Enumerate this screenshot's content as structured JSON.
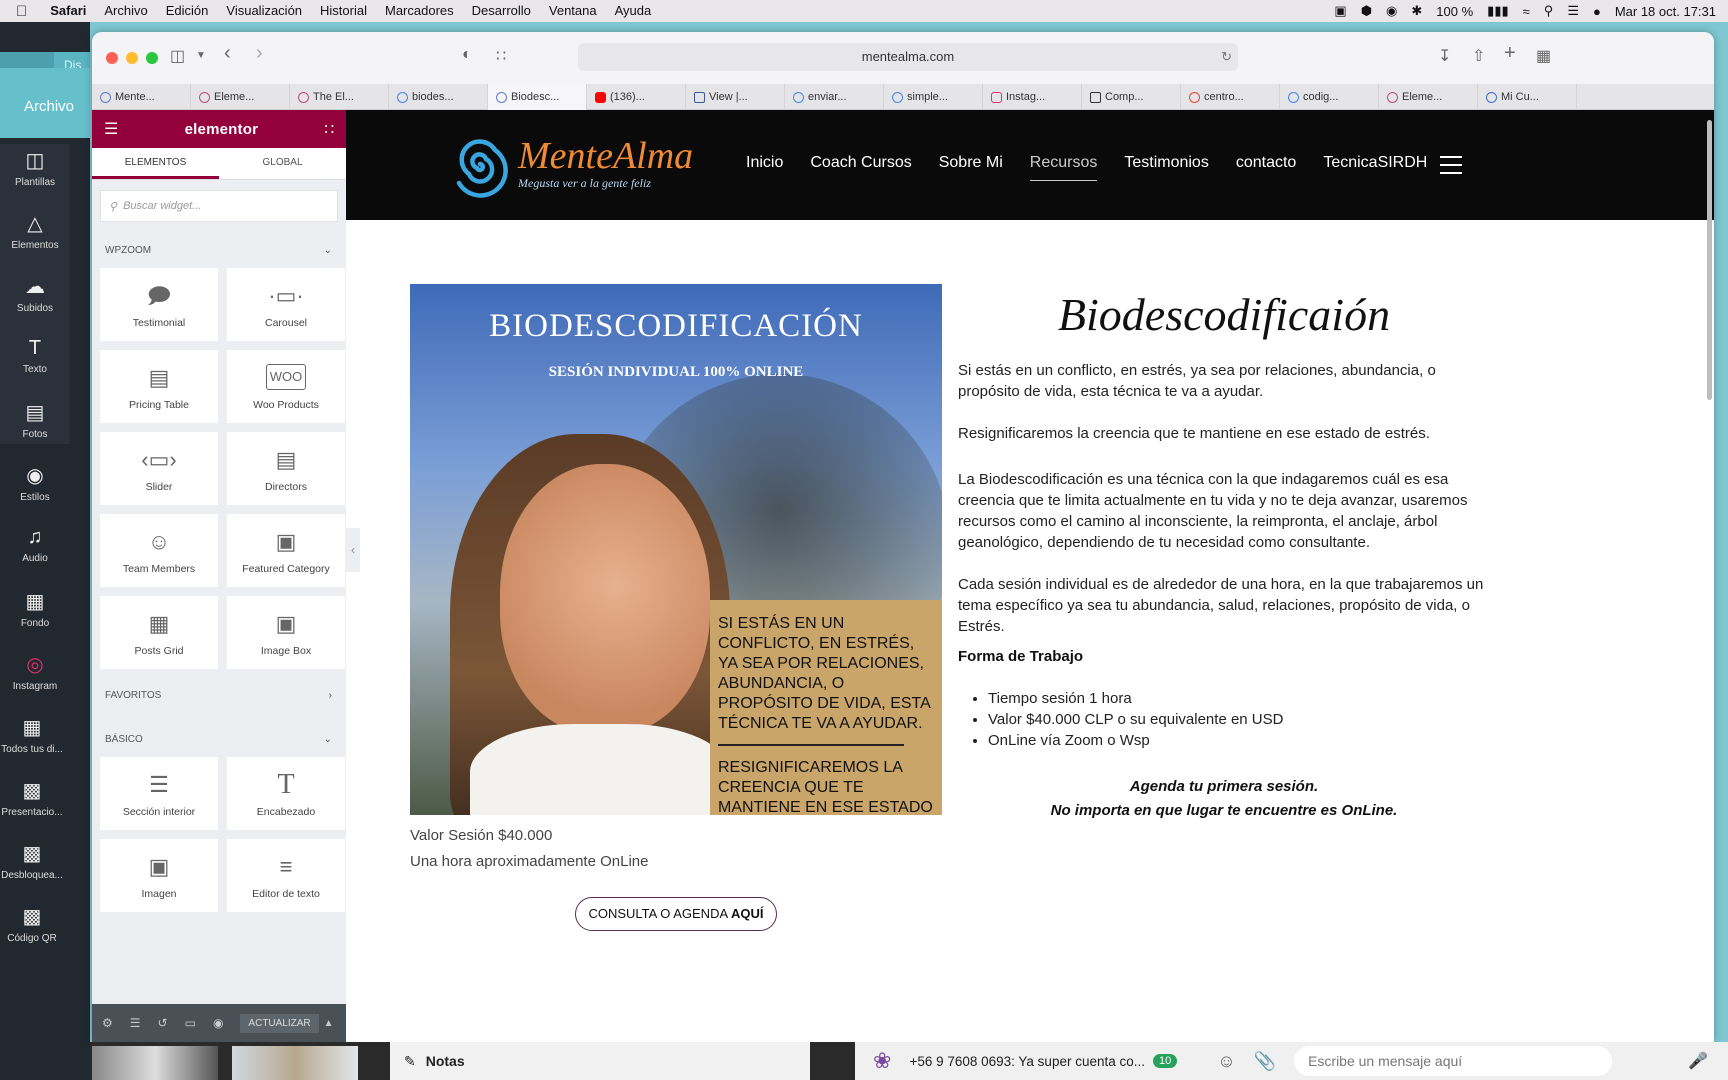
{
  "menubar": {
    "app": "Safari",
    "items": [
      "Archivo",
      "Edición",
      "Visualización",
      "Historial",
      "Marcadores",
      "Desarrollo",
      "Ventana",
      "Ayuda"
    ],
    "battery": "100 %",
    "datetime": "Mar 18 oct.  17:31"
  },
  "background_app": {
    "archivo": "Archivo",
    "partial_tab": "Dis",
    "sidebar": [
      {
        "label": "Plantillas",
        "icon": "templates-icon"
      },
      {
        "label": "Elementos",
        "icon": "elements-icon"
      },
      {
        "label": "Subidos",
        "icon": "upload-icon"
      },
      {
        "label": "Texto",
        "icon": "text-icon"
      },
      {
        "label": "Fotos",
        "icon": "photos-icon"
      },
      {
        "label": "Estilos",
        "icon": "styles-icon"
      },
      {
        "label": "Audio",
        "icon": "audio-icon"
      },
      {
        "label": "Fondo",
        "icon": "background-icon"
      },
      {
        "label": "Instagram",
        "icon": "instagram-icon"
      },
      {
        "label": "Todos tus di...",
        "icon": "all-designs-icon"
      },
      {
        "label": "Presentacio...",
        "icon": "presentation-icon"
      },
      {
        "label": "Desbloquea...",
        "icon": "unlock-icon"
      },
      {
        "label": "Código QR",
        "icon": "qr-icon"
      }
    ]
  },
  "browser": {
    "url": "mentealma.com",
    "tabs": [
      "Mente...",
      "Eleme...",
      "The El...",
      "biodes...",
      "Biodesc...",
      "(136)...",
      "View |...",
      "enviar...",
      "simple...",
      "Instag...",
      "Comp...",
      "centro...",
      "codig...",
      "Eleme...",
      "Mi Cu..."
    ],
    "active_tab": 4
  },
  "elementor": {
    "logo": "elementor",
    "tabs": [
      "ELEMENTOS",
      "GLOBAL"
    ],
    "search_placeholder": "Buscar widget...",
    "wpzoom_label": "WPZOOM",
    "wpzoom_widgets": [
      {
        "label": "Testimonial",
        "icon": "testimonial-icon"
      },
      {
        "label": "Carousel",
        "icon": "carousel-icon"
      },
      {
        "label": "Pricing Table",
        "icon": "pricing-table-icon"
      },
      {
        "label": "Woo Products",
        "icon": "woo-products-icon"
      },
      {
        "label": "Slider",
        "icon": "slider-icon"
      },
      {
        "label": "Directors",
        "icon": "directors-icon"
      },
      {
        "label": "Team Members",
        "icon": "team-members-icon"
      },
      {
        "label": "Featured Category",
        "icon": "featured-category-icon"
      },
      {
        "label": "Posts Grid",
        "icon": "posts-grid-icon"
      },
      {
        "label": "Image Box",
        "icon": "image-box-icon"
      }
    ],
    "favoritos_label": "FAVORITOS",
    "basico_label": "BÁSICO",
    "basico_widgets": [
      {
        "label": "Sección interior",
        "icon": "inner-section-icon"
      },
      {
        "label": "Encabezado",
        "icon": "heading-icon"
      },
      {
        "label": "Imagen",
        "icon": "image-icon"
      },
      {
        "label": "Editor de texto",
        "icon": "text-editor-icon"
      }
    ],
    "update_label": "ACTUALIZAR"
  },
  "site": {
    "brand": "MenteAlma",
    "tagline": "Megusta ver a la gente feliz",
    "nav": [
      "Inicio",
      "Coach Cursos",
      "Sobre Mi",
      "Recursos",
      "Testimonios",
      "contacto",
      "TecnicaSIRDH"
    ],
    "nav_active": 3,
    "hero": {
      "title": "BIODESCODIFICACIÓN",
      "subtitle": "SESIÓN INDIVIDUAL 100% ONLINE",
      "box_1": "SI ESTÁS EN UN CONFLICTO, EN ESTRÉS, YA SEA POR RELACIONES, ABUNDANCIA, O PROPÓSITO DE VIDA, ESTA TÉCNICA TE VA A AYUDAR.",
      "box_2": "RESIGNIFICAREMOS LA CREENCIA QUE TE MANTIENE EN ESE ESTADO DE ESTRÉS"
    },
    "price_caption": "Valor Sesión $40.000",
    "duration_caption": "Una hora aproximadamente OnLine",
    "cta_prefix": "CONSULTA O AGENDA ",
    "cta_bold": "AQUÍ",
    "heading": "Biodescodificaión",
    "paragraphs": [
      "Si estás en un conflicto, en estrés, ya sea por relaciones, abundancia, o propósito de vida, esta técnica te va a ayudar.",
      "Resignificaremos la creencia que te mantiene en ese estado de estrés.",
      "La Biodescodificación es una técnica con la que indagaremos cuál es esa creencia que te limita actualmente en tu vida y no te deja avanzar, usaremos recursos como el camino al inconsciente, la reimpronta, el anclaje, árbol geanológico, dependiendo de tu necesidad como consultante.",
      "Cada sesión individual es de alrededor de una hora, en la que trabajaremos un tema específico ya sea tu abundancia, salud, relaciones, propósito de vida, o Estrés."
    ],
    "work_heading": "Forma de Trabajo",
    "bullets": [
      "Tiempo sesión 1 hora",
      "Valor $40.000 CLP o su equivalente en USD",
      "OnLine vía Zoom o Wsp"
    ],
    "schedule_line_1": "Agenda tu primera sesión.",
    "schedule_line_2": "No importa en que lugar te encuentre es OnLine."
  },
  "bottom": {
    "notes_label": "Notas",
    "wa_message": "+56 9 7608 0693: Ya super cuenta co...",
    "wa_badge": "10",
    "wa_input_placeholder": "Escribe un mensaje aquí"
  }
}
